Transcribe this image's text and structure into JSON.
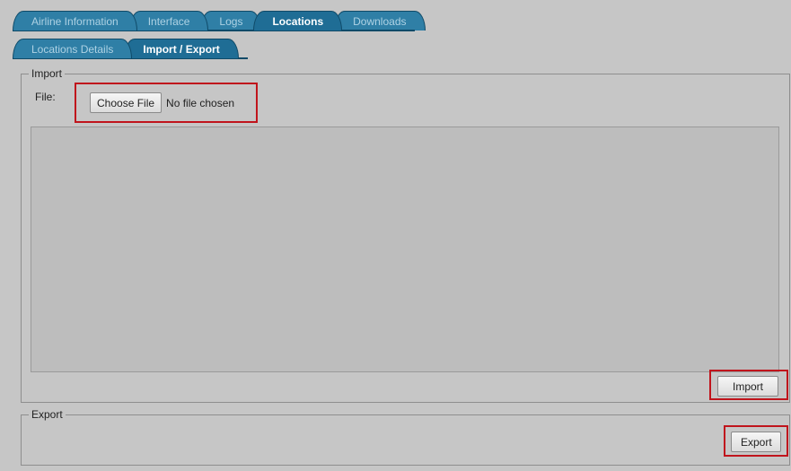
{
  "tabs": {
    "top": [
      {
        "label": "Airline Information",
        "active": false
      },
      {
        "label": "Interface",
        "active": false
      },
      {
        "label": "Logs",
        "active": false
      },
      {
        "label": "Locations",
        "active": true
      },
      {
        "label": "Downloads",
        "active": false
      }
    ],
    "sub": [
      {
        "label": "Locations Details",
        "active": false
      },
      {
        "label": "Import / Export",
        "active": true
      }
    ]
  },
  "import_section": {
    "legend": "Import",
    "file_label": "File:",
    "choose_button": "Choose File",
    "file_status": "No file chosen",
    "textarea_value": "",
    "import_button": "Import"
  },
  "export_section": {
    "legend": "Export",
    "export_button": "Export"
  },
  "colors": {
    "background": "#c6c6c6",
    "tab": "#2f7fa6",
    "tab_active": "#1f6d95",
    "highlight": "#c0141c"
  }
}
